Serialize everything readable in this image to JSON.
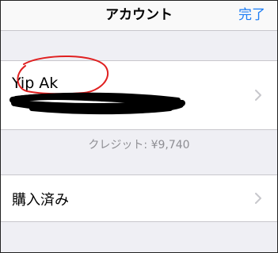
{
  "nav": {
    "title": "アカウント",
    "done_label": "完了"
  },
  "account": {
    "name": "Yip Ak"
  },
  "credit_text": "クレジット: ¥9,740",
  "purchased": {
    "label": "購入済み"
  },
  "colors": {
    "accent": "#1a7cf5",
    "background": "#efeff4",
    "annotation_circle": "#e02020",
    "redaction": "#000000"
  },
  "icons": {
    "row_chevron": "chevron-right-icon"
  }
}
